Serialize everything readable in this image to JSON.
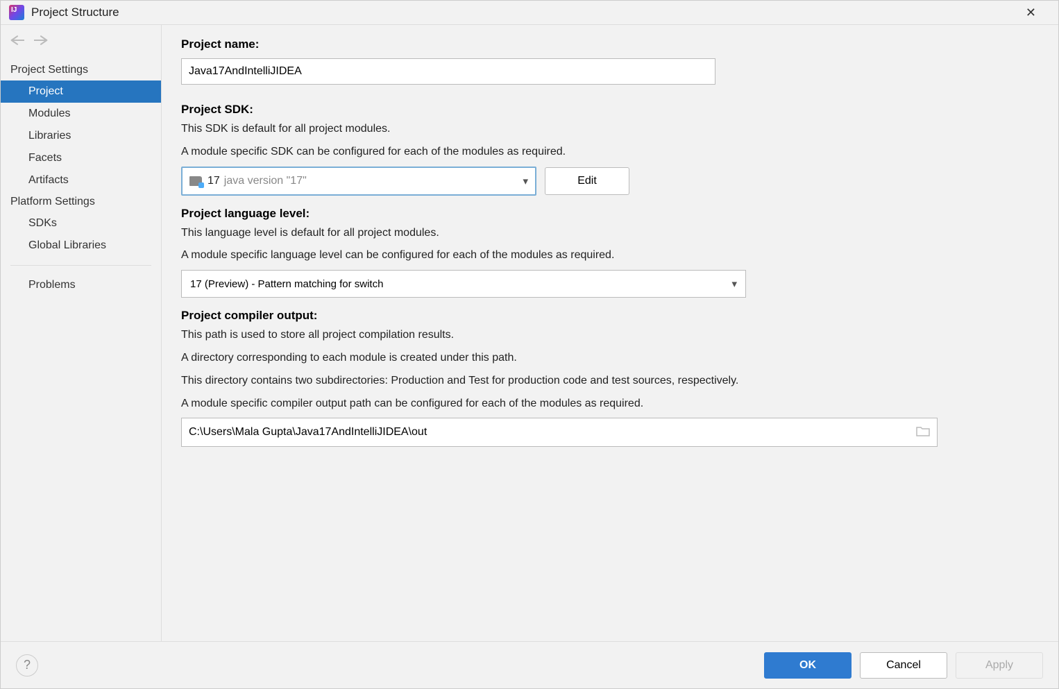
{
  "window": {
    "title": "Project Structure"
  },
  "sidebar": {
    "sections": [
      {
        "label": "Project Settings",
        "items": [
          "Project",
          "Modules",
          "Libraries",
          "Facets",
          "Artifacts"
        ]
      },
      {
        "label": "Platform Settings",
        "items": [
          "SDKs",
          "Global Libraries"
        ]
      }
    ],
    "extra": "Problems"
  },
  "project": {
    "name_label": "Project name:",
    "name_value": "Java17AndIntelliJIDEA",
    "sdk_label": "Project SDK:",
    "sdk_desc1": "This SDK is default for all project modules.",
    "sdk_desc2": "A module specific SDK can be configured for each of the modules as required.",
    "sdk_main": "17",
    "sdk_version": "java version \"17\"",
    "edit_label": "Edit",
    "lang_label": "Project language level:",
    "lang_desc1": "This language level is default for all project modules.",
    "lang_desc2": "A module specific language level can be configured for each of the modules as required.",
    "lang_value": "17 (Preview) - Pattern matching for switch",
    "out_label": "Project compiler output:",
    "out_desc1": "This path is used to store all project compilation results.",
    "out_desc2": "A directory corresponding to each module is created under this path.",
    "out_desc3": "This directory contains two subdirectories: Production and Test for production code and test sources, respectively.",
    "out_desc4": "A module specific compiler output path can be configured for each of the modules as required.",
    "out_value": "C:\\Users\\Mala Gupta\\Java17AndIntelliJIDEA\\out"
  },
  "footer": {
    "ok": "OK",
    "cancel": "Cancel",
    "apply": "Apply"
  }
}
